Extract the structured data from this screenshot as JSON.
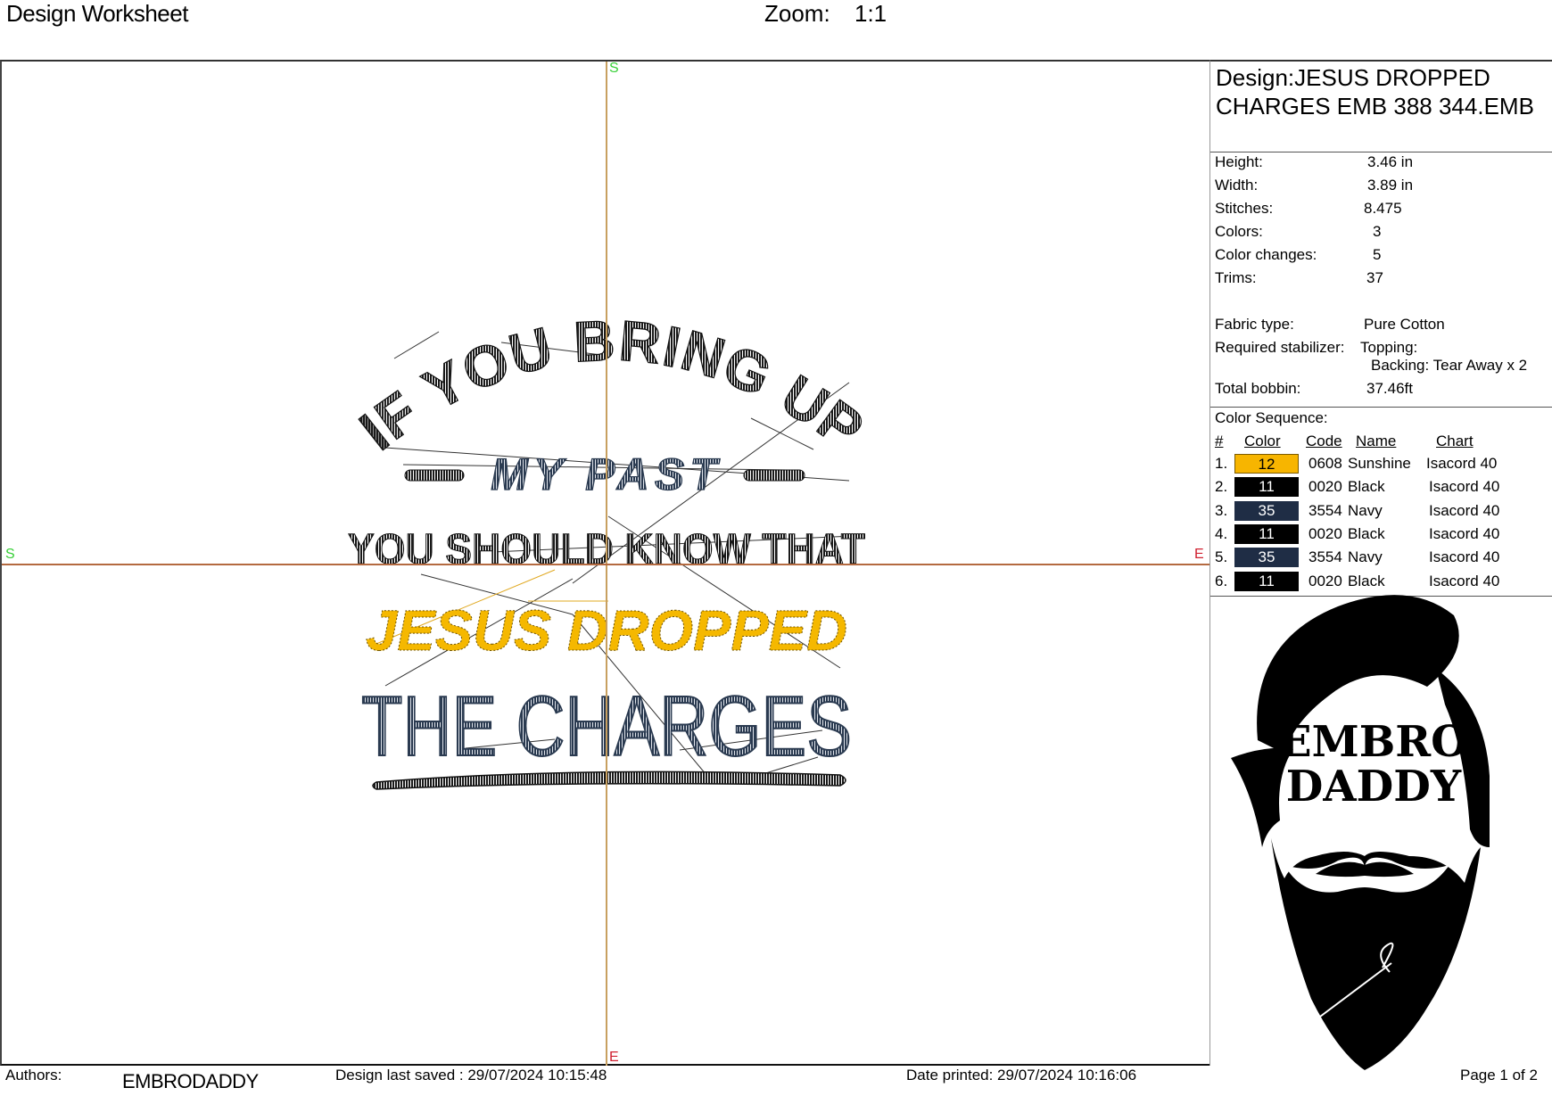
{
  "header": {
    "title": "Design Worksheet",
    "zoom_label": "Zoom:",
    "zoom_value": "1:1"
  },
  "canvas": {
    "axis_marks": {
      "top": "S",
      "left": "S",
      "right": "E",
      "bottom": "E"
    },
    "design_lines": [
      {
        "text": "IF YOU BRING UP",
        "color": "#1a1a1a"
      },
      {
        "text": "MY PAST",
        "color": "#2a3a50"
      },
      {
        "text": "YOU SHOULD KNOW THAT",
        "color": "#1a1a1a"
      },
      {
        "text": "JESUS DROPPED",
        "color": "#f5b800"
      },
      {
        "text": "THE CHARGES",
        "color": "#2a3a50"
      }
    ]
  },
  "panel": {
    "design_title": "Design:JESUS DROPPED CHARGES EMB 388 344.EMB",
    "specs": [
      {
        "label": "Height:",
        "value": "3.46 in"
      },
      {
        "label": "Width:",
        "value": "3.89 in"
      },
      {
        "label": "Stitches:",
        "value": "8.475"
      },
      {
        "label": "Colors:",
        "value": "3"
      },
      {
        "label": "Color changes:",
        "value": "5"
      },
      {
        "label": "Trims:",
        "value": "37"
      }
    ],
    "fabric_label": "Fabric type:",
    "fabric_value": "Pure Cotton",
    "stabilizer_label": "Required stabilizer:",
    "stabilizer_topping": "Topping:",
    "stabilizer_backing": "Backing: Tear Away x 2",
    "bobbin_label": "Total bobbin:",
    "bobbin_value": "37.46ft",
    "color_sequence_title": "Color Sequence:",
    "columns": [
      "#",
      "Color",
      "Code",
      "Name",
      "Chart"
    ],
    "colors": [
      {
        "num": "1.",
        "swatch": "12",
        "hex": "#f7b500",
        "text_color": "#000000",
        "code": "0608",
        "name": "Sunshine",
        "chart": "Isacord 40"
      },
      {
        "num": "2.",
        "swatch": "11",
        "hex": "#000000",
        "text_color": "#ffffff",
        "code": "0020",
        "name": "Black",
        "chart": "Isacord 40"
      },
      {
        "num": "3.",
        "swatch": "35",
        "hex": "#1f2d45",
        "text_color": "#ffffff",
        "code": "3554",
        "name": "Navy",
        "chart": "Isacord 40"
      },
      {
        "num": "4.",
        "swatch": "11",
        "hex": "#000000",
        "text_color": "#ffffff",
        "code": "0020",
        "name": "Black",
        "chart": "Isacord 40"
      },
      {
        "num": "5.",
        "swatch": "35",
        "hex": "#1f2d45",
        "text_color": "#ffffff",
        "code": "3554",
        "name": "Navy",
        "chart": "Isacord 40"
      },
      {
        "num": "6.",
        "swatch": "11",
        "hex": "#000000",
        "text_color": "#ffffff",
        "code": "0020",
        "name": "Black",
        "chart": "Isacord 40"
      }
    ],
    "logo": {
      "line1": "EMBRO",
      "line2": "DADDY"
    }
  },
  "footer": {
    "authors_label": "Authors:",
    "authors_value": "EMBRODADDY",
    "last_saved": "Design last saved : 29/07/2024 10:15:48",
    "date_printed": "Date printed: 29/07/2024 10:16:06",
    "page": "Page 1 of 2"
  }
}
